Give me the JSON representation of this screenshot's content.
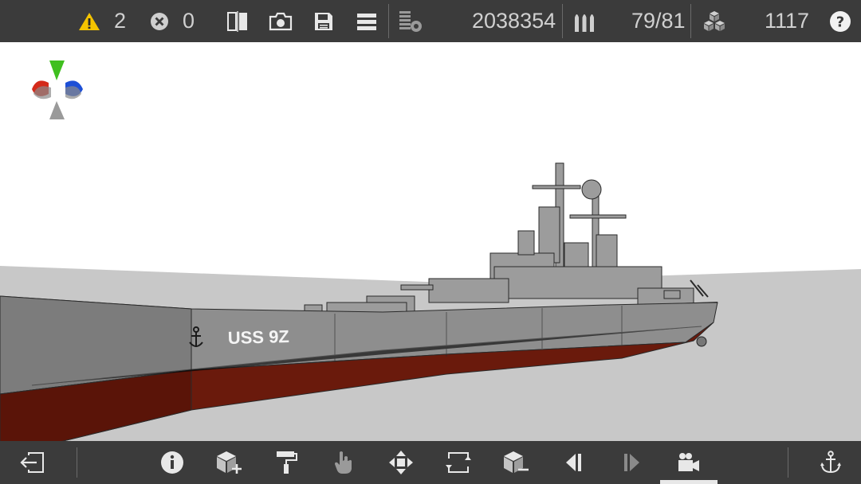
{
  "status": {
    "warnings_count": "2",
    "errors_count": "0",
    "mass_value": "2038354",
    "ammo_value": "79/81",
    "parts_value": "1117"
  },
  "ship": {
    "hull_label": "USS 9Z"
  },
  "colors": {
    "toolbar_bg": "#3b3b3b",
    "warning": "#f5c400",
    "hull_red": "#6a1a0c",
    "hull_gray": "#8e8e8e",
    "axis_green": "#3fbf1f",
    "axis_red": "#d42a1a",
    "axis_blue": "#1d4fd6"
  },
  "icons": {
    "top": [
      "warning-icon",
      "error-icon",
      "mirror-icon",
      "camera-icon",
      "save-icon",
      "menu-icon",
      "mass-icon",
      "ammo-icon",
      "parts-icon",
      "help-icon"
    ],
    "bottom": [
      "exit-icon",
      "info-icon",
      "add-block-icon",
      "paint-roller-icon",
      "hand-pointer-icon",
      "move-icon",
      "rotate-icon",
      "remove-block-icon",
      "undo-icon",
      "redo-icon",
      "camera-mode-icon",
      "anchor-icon"
    ]
  }
}
